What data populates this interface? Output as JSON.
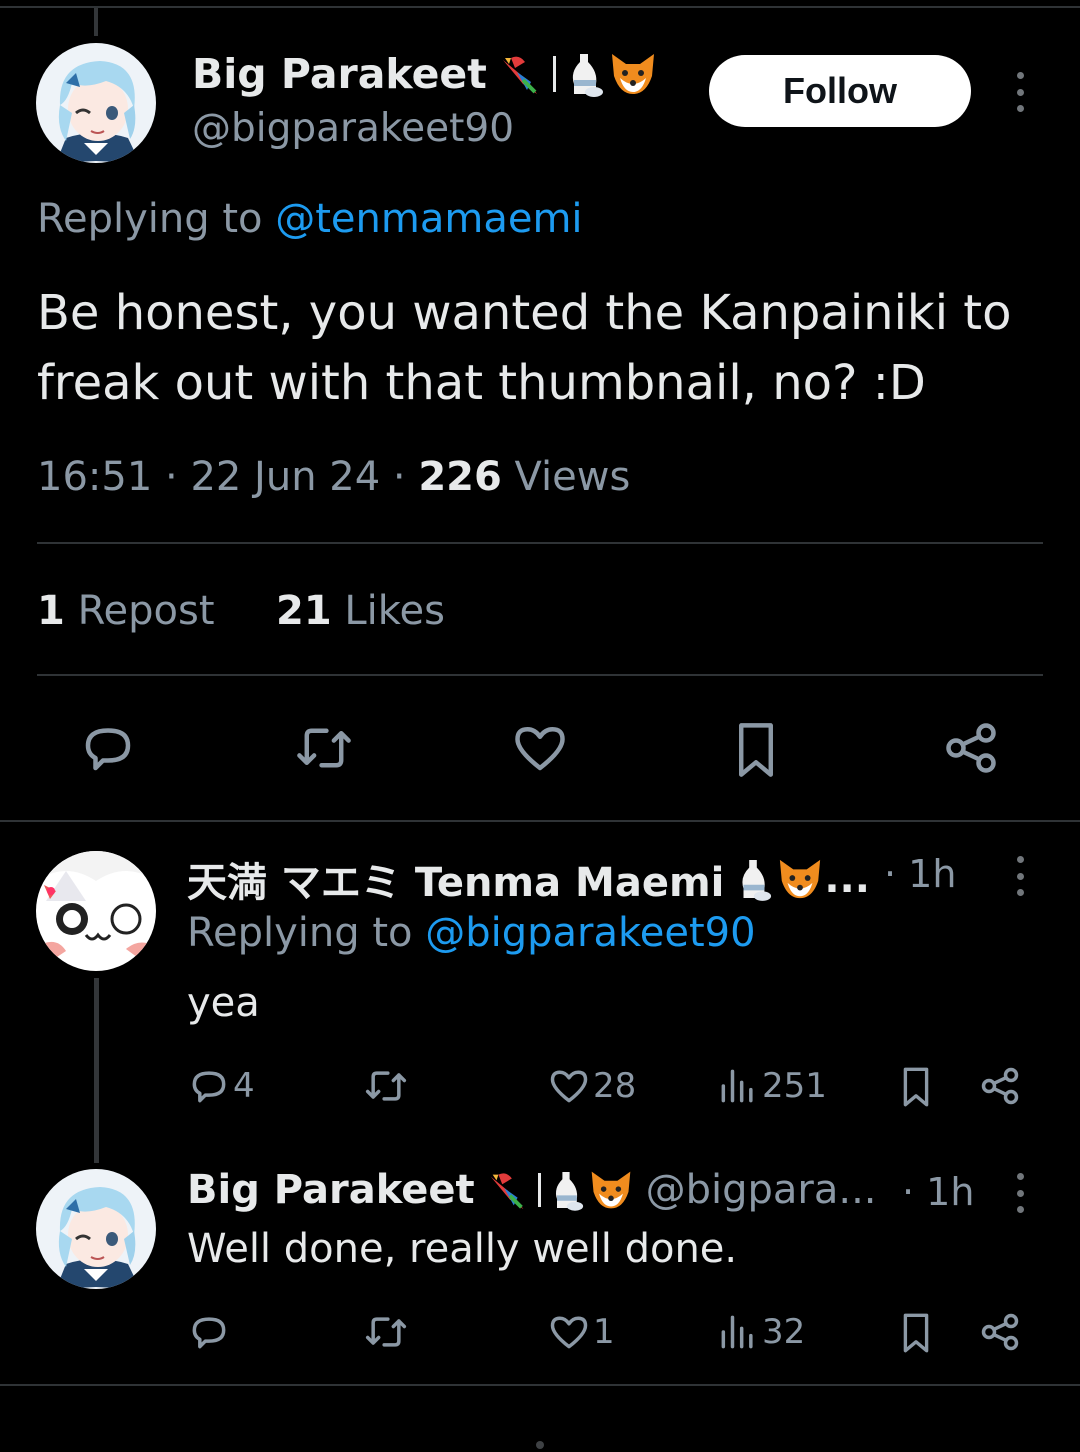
{
  "main_tweet": {
    "author_name": "Big Parakeet",
    "author_handle": "@bigparakeet90",
    "follow_label": "Follow",
    "replying_prefix": "Replying to",
    "replying_handle": "@tenmamaemi",
    "text": "Be honest, you wanted the Kanpainiki to freak out with that thumbnail, no? :D",
    "time": "16:51",
    "date": "22 Jun 24",
    "views_count": "226",
    "views_label": "Views",
    "reposts_count": "1",
    "reposts_label": "Repost",
    "likes_count": "21",
    "likes_label": "Likes",
    "actions": [
      "reply-icon",
      "repost-icon",
      "like-icon",
      "bookmark-icon",
      "share-icon"
    ]
  },
  "replies": [
    {
      "author_name": "天満 マエミ Tenma Maemi",
      "ellipsis": "...",
      "time": "· 1h",
      "replying_prefix": "Replying to",
      "replying_handle": "@bigparakeet90",
      "text": "yea",
      "reply_count": "4",
      "like_count": "28",
      "view_count": "251"
    },
    {
      "author_name": "Big Parakeet",
      "author_handle": "@bigpara...",
      "time": "· 1h",
      "text": "Well done, really well done.",
      "like_count": "1",
      "view_count": "32"
    }
  ],
  "colors": {
    "background": "#000000",
    "text": "#e7e9ea",
    "muted": "#8b98a5",
    "link": "#1d9bf0",
    "divider": "#2f3336"
  }
}
